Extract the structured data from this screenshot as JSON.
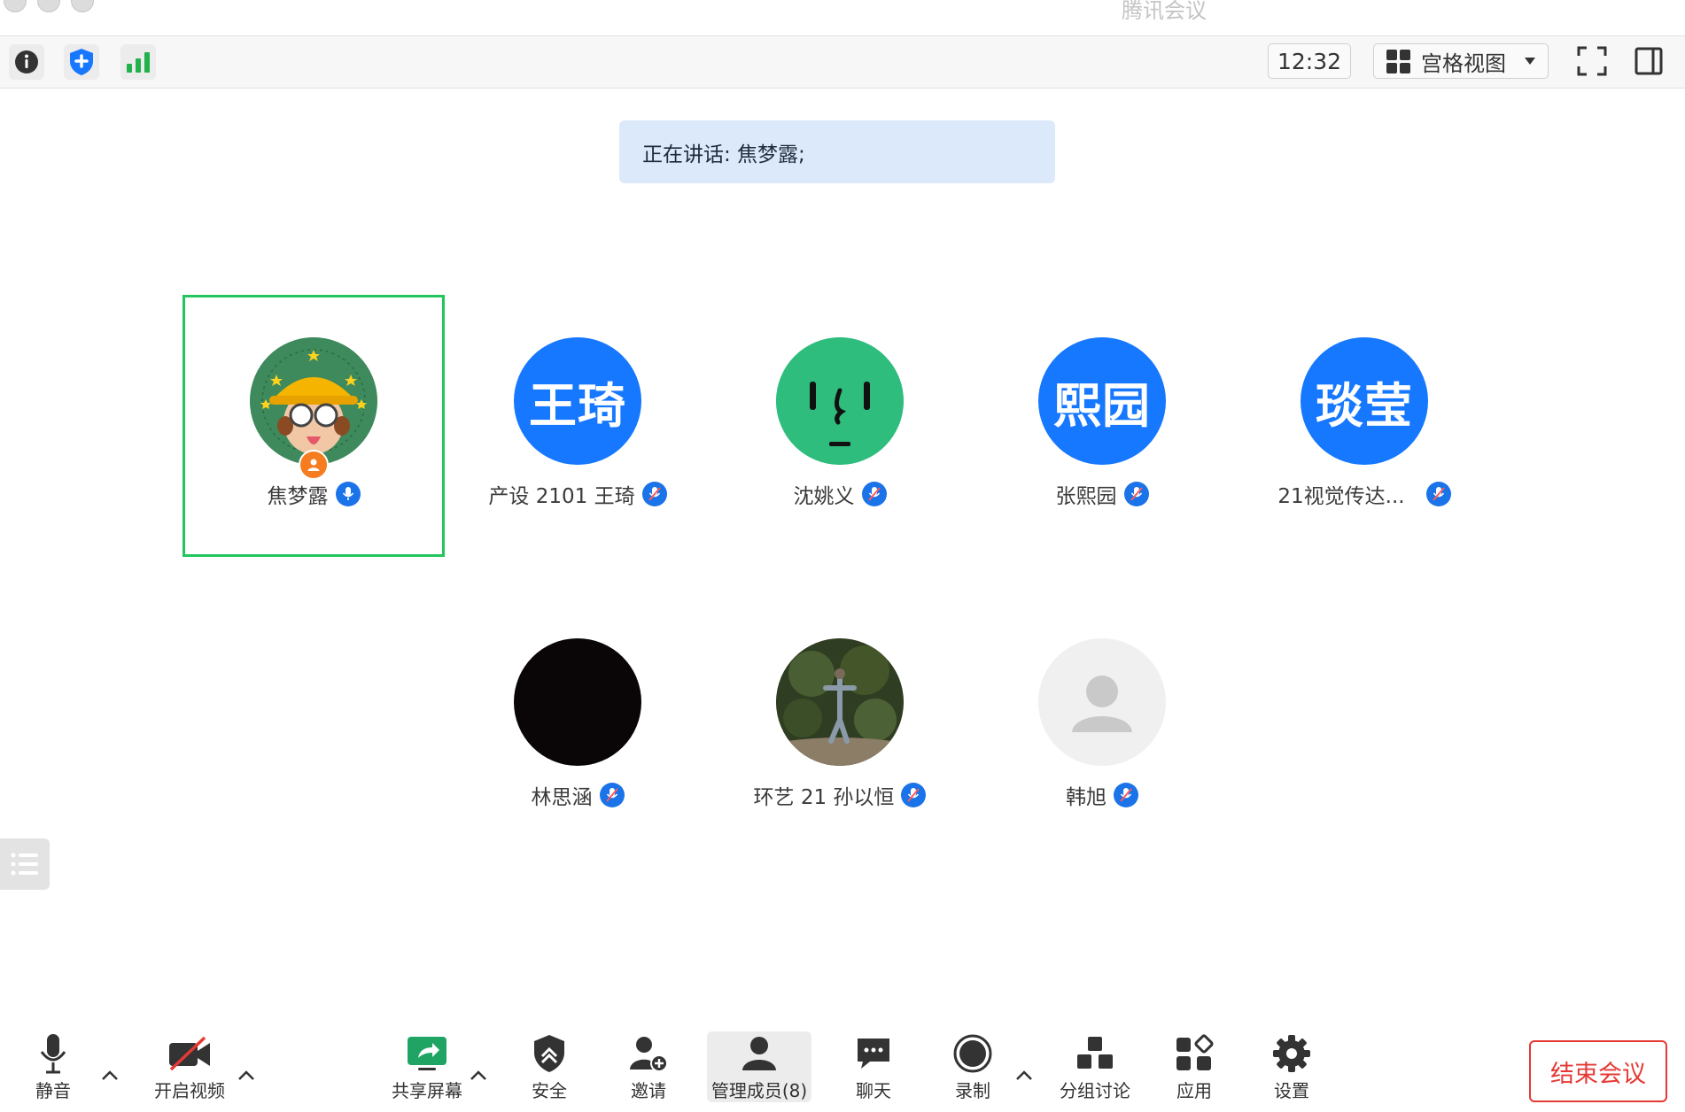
{
  "window": {
    "title": "腾讯会议"
  },
  "topbar": {
    "info_icon": "info-icon",
    "security_icon": "shield-icon",
    "signal_icon": "signal-bars-icon",
    "time": "12:32",
    "view_label": "宫格视图",
    "fullscreen_icon": "fullscreen-icon",
    "sidebar_icon": "sidebar-toggle-icon"
  },
  "speaking": {
    "label": "正在讲话: 焦梦露;"
  },
  "participants": [
    {
      "name": "焦梦露",
      "avatar_text": "",
      "avatar_color": "#3f8a5c",
      "is_host": true,
      "active_speaker": true
    },
    {
      "name": "产设 2101 王琦",
      "avatar_text": "王琦",
      "avatar_color": "#1677ff"
    },
    {
      "name": "沈姚义",
      "avatar_text": "",
      "avatar_color": "#2ebd7d"
    },
    {
      "name": "张熙园",
      "avatar_text": "熙园",
      "avatar_color": "#1677ff"
    },
    {
      "name": "21视觉传达...",
      "avatar_text": "琰莹",
      "avatar_color": "#1677ff"
    },
    {
      "name": "林思涵",
      "avatar_text": "",
      "avatar_color": "#0a0608"
    },
    {
      "name": "环艺 21 孙以恒",
      "avatar_text": "",
      "avatar_color": "#3c4a2c"
    },
    {
      "name": "韩旭",
      "avatar_text": "",
      "avatar_color": "#f0f0f0"
    }
  ],
  "toolbar": {
    "mute": "静音",
    "video": "开启视频",
    "share": "共享屏幕",
    "security": "安全",
    "invite": "邀请",
    "members": "管理成员(8)",
    "chat": "聊天",
    "record": "录制",
    "breakout": "分组讨论",
    "apps": "应用",
    "settings": "设置",
    "end": "结束会议"
  },
  "colors": {
    "accent": "#1677ff",
    "active_border": "#22c55e",
    "end_red": "#e53935",
    "banner_bg": "#dbe9fa"
  }
}
